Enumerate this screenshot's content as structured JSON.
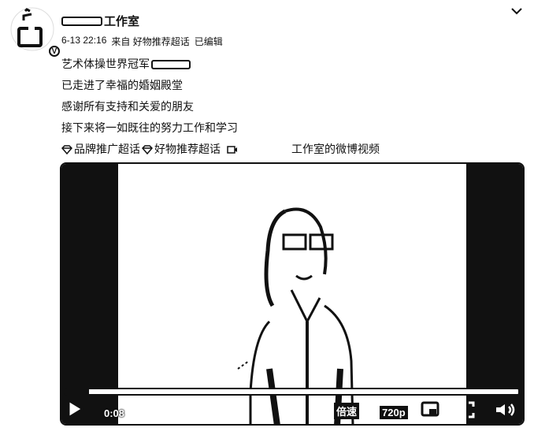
{
  "header": {
    "author_name": "工作室",
    "menu_icon": "chevron-down-icon"
  },
  "meta": {
    "date": "6-13 22:16",
    "source": "来自 好物推荐超话",
    "edited": "已编辑"
  },
  "post": {
    "lines": [
      "艺术体操世界冠军",
      "已走进了幸福的婚姻殿堂",
      "感谢所有支持和关爱的朋友",
      "接下来将一如既往的努力工作和学习"
    ]
  },
  "tags": [
    {
      "icon": "gem-icon",
      "label": "品牌推广超话"
    },
    {
      "icon": "gem-icon",
      "label": "好物推荐超话"
    },
    {
      "icon": "video-camera-icon",
      "label": "工作室的微博视频"
    }
  ],
  "video": {
    "time": "0:08",
    "speed_label": "倍速",
    "quality_label": "720p",
    "progress": 0.05
  }
}
